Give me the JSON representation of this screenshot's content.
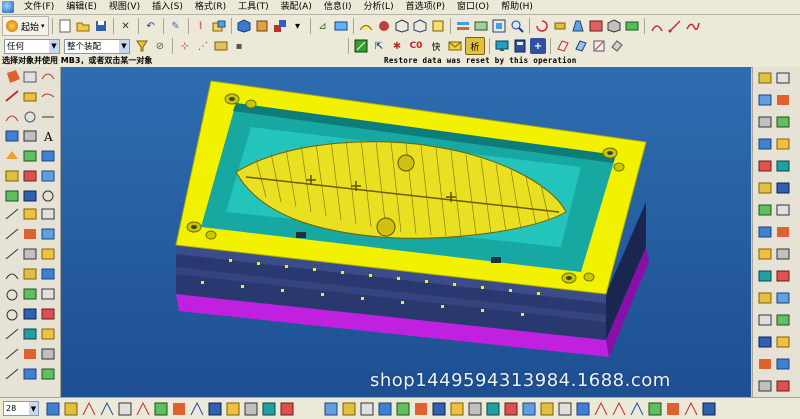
{
  "menubar": {
    "items": [
      "文件(F)",
      "编辑(E)",
      "视图(V)",
      "插入(S)",
      "格式(R)",
      "工具(T)",
      "装配(A)",
      "信息(I)",
      "分析(L)",
      "首选项(P)",
      "窗口(O)",
      "帮助(H)"
    ]
  },
  "toolbar": {
    "start_label": "起始",
    "filter_combo": "任何",
    "assembly_combo": "整个装配",
    "coord_label": "C0",
    "quick_label": "快",
    "analyze_label": "析"
  },
  "status": {
    "prompt": "选择对象并使用 MB3，或者双击某一对象",
    "message": "Restore data was reset by this operation"
  },
  "bottom": {
    "zoom_value": "28"
  },
  "watermark": {
    "text": "shop1449594313984.1688.com"
  },
  "colors": {
    "viewport_bg": "#2a62a8",
    "mold_plate": "#f0f000",
    "cavity": "#17a7a0",
    "base": "#2b3a6a",
    "bottom_plate": "#b020d0"
  }
}
